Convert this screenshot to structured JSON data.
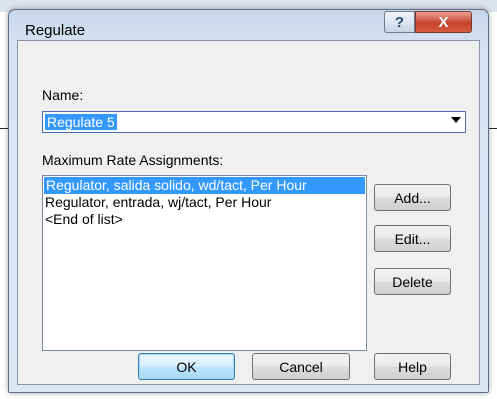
{
  "window": {
    "title": "Regulate"
  },
  "titlebar": {
    "help_glyph": "?",
    "close_glyph": "X"
  },
  "name": {
    "label": "Name:",
    "value": "Regulate 5"
  },
  "assignments": {
    "label": "Maximum Rate Assignments:",
    "items": [
      "Regulator, salida solido, wd/tact, Per Hour",
      "Regulator, entrada, wj/tact, Per Hour",
      "<End of list>"
    ],
    "selected_index": 0
  },
  "side_buttons": {
    "add": "Add...",
    "edit": "Edit...",
    "delete": "Delete"
  },
  "bottom_buttons": {
    "ok": "OK",
    "cancel": "Cancel",
    "help": "Help"
  },
  "colors": {
    "selection": "#3399ff",
    "dialog_frame": "#d7e4f3",
    "close": "#c7432d"
  }
}
